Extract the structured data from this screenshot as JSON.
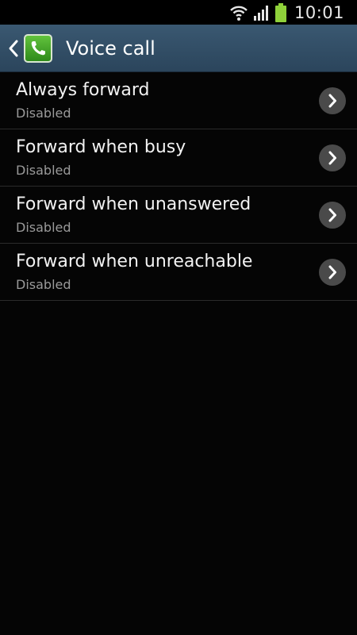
{
  "status_bar": {
    "time": "10:01",
    "icons": [
      "wifi-icon",
      "signal-icon",
      "battery-icon"
    ]
  },
  "action_bar": {
    "title": "Voice call",
    "back_icon": "chevron-left-icon",
    "app_icon": "phone-icon"
  },
  "items": [
    {
      "title": "Always forward",
      "status": "Disabled"
    },
    {
      "title": "Forward when busy",
      "status": "Disabled"
    },
    {
      "title": "Forward when unanswered",
      "status": "Disabled"
    },
    {
      "title": "Forward when unreachable",
      "status": "Disabled"
    }
  ],
  "colors": {
    "action_bar": "#2f4b63",
    "background": "#050505",
    "battery": "#8fd13a"
  }
}
